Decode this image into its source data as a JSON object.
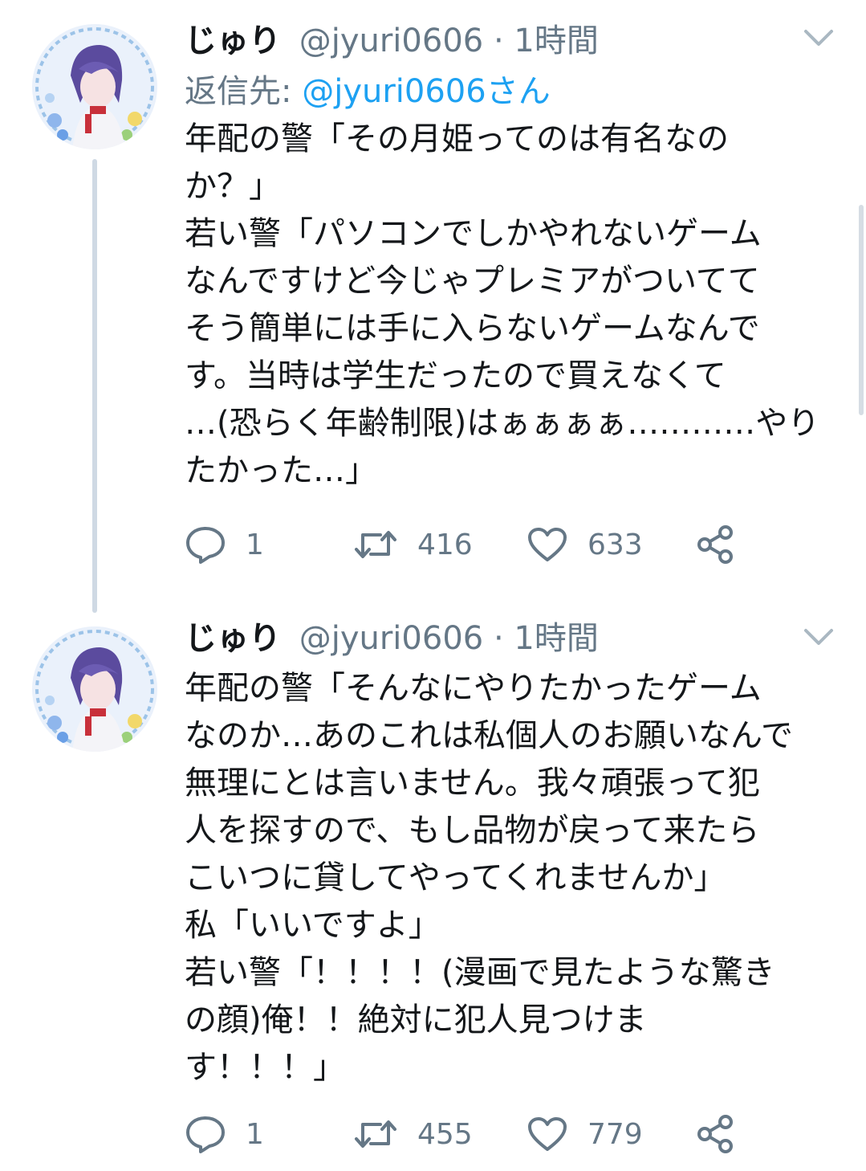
{
  "tweets": [
    {
      "name": "じゅり",
      "handle": "@jyuri0606",
      "separator": "·",
      "time": "1時間",
      "reply_label": "返信先:",
      "reply_handle": "@jyuri0606さん",
      "lines": [
        "年配の警「その月姫ってのは有名なの",
        "か？」",
        "若い警「パソコンでしかやれないゲーム",
        "なんですけど今じゃプレミアがついてて",
        "そう簡単には手に入らないゲームなんで",
        "す。当時は学生だったので買えなくて",
        "…(恐らく年齢制限)はぁぁぁぁ…………やり",
        "たかった…」"
      ],
      "reply_count": "1",
      "retweet_count": "416",
      "like_count": "633"
    },
    {
      "name": "じゅり",
      "handle": "@jyuri0606",
      "separator": "·",
      "time": "1時間",
      "lines": [
        "年配の警「そんなにやりたかったゲーム",
        "なのか…あのこれは私個人のお願いなんで",
        "無理にとは言いません。我々頑張って犯",
        "人を探すので、もし品物が戻って来たら",
        "こいつに貸してやってくれませんか」",
        "私「いいですよ」",
        "若い警「！！！！(漫画で見たような驚き",
        "の顔)俺！！絶対に犯人見つけま",
        "す！！！」"
      ],
      "reply_count": "1",
      "retweet_count": "455",
      "like_count": "779"
    }
  ],
  "icons": {
    "reply": "reply-icon",
    "retweet": "retweet-icon",
    "like": "heart-icon",
    "share": "share-icon",
    "more": "chevron-down-icon"
  },
  "colors": {
    "text": "#14171a",
    "muted": "#657786",
    "link": "#1da1f2",
    "thread": "#cfd9e4"
  }
}
